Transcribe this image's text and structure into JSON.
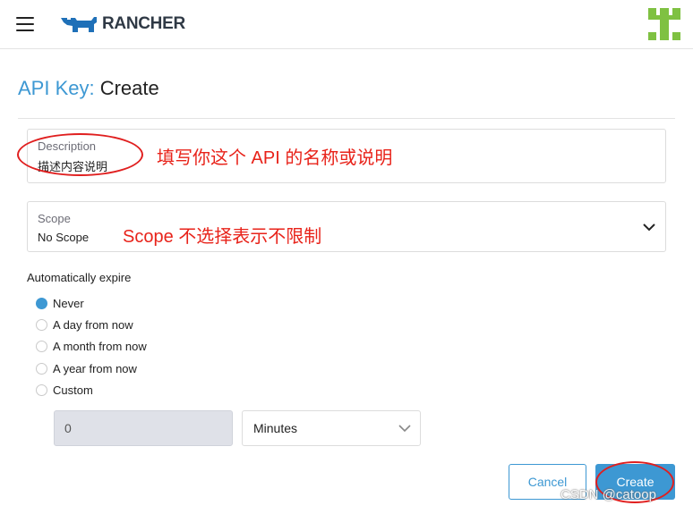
{
  "header": {
    "logo_text": "RANCHER",
    "brand_color": "#1f70b8",
    "avatar_color": "#7fc142"
  },
  "page": {
    "title_label": "API Key:",
    "title_value": "Create"
  },
  "description": {
    "label": "Description",
    "value": "描述内容说明",
    "annotation": "填写你这个 API 的名称或说明"
  },
  "scope": {
    "label": "Scope",
    "value": "No Scope",
    "annotation": "Scope 不选择表示不限制"
  },
  "expire": {
    "label": "Automatically expire",
    "options": [
      {
        "label": "Never",
        "checked": true
      },
      {
        "label": "A day from now",
        "checked": false
      },
      {
        "label": "A month from now",
        "checked": false
      },
      {
        "label": "A year from now",
        "checked": false
      },
      {
        "label": "Custom",
        "checked": false
      }
    ],
    "custom_value": "0",
    "custom_unit": "Minutes"
  },
  "actions": {
    "cancel_label": "Cancel",
    "create_label": "Create"
  },
  "watermark": "CSDN @catoop",
  "colors": {
    "accent": "#3d98d3",
    "annotation": "#e8231a"
  }
}
